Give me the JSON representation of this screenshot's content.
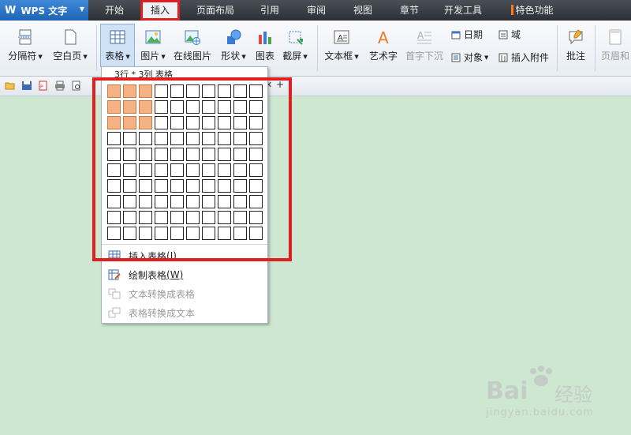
{
  "app": {
    "logo": "W",
    "name": "WPS 文字"
  },
  "menu_tabs": [
    "开始",
    "插入",
    "页面布局",
    "引用",
    "审阅",
    "视图",
    "章节",
    "开发工具",
    "特色功能"
  ],
  "ribbon": {
    "section_break": "分隔符",
    "blank_page": "空白页",
    "table": "表格",
    "picture": "图片",
    "online_picture": "在线图片",
    "shapes": "形状",
    "chart": "图表",
    "screenshot": "截屏",
    "text_box": "文本框",
    "word_art": "艺术字",
    "drop_cap": "首字下沉",
    "date": "日期",
    "object": "对象",
    "field": "域",
    "insert_attachment": "插入附件",
    "comment": "批注",
    "header_footer": "页眉和"
  },
  "table_dropdown": {
    "grid_caption": "3行 * 3列 表格",
    "rows": 10,
    "cols": 10,
    "selected_rows": 3,
    "selected_cols": 3,
    "items": [
      {
        "label": "插入表格",
        "accel": "(I)",
        "enabled": true
      },
      {
        "label": "绘制表格",
        "accel": "(W)",
        "enabled": true
      },
      {
        "label": "文本转换成表格",
        "accel": "",
        "enabled": false
      },
      {
        "label": "表格转换成文本",
        "accel": "",
        "enabled": false
      }
    ]
  },
  "watermark": {
    "brand": "Bai",
    "brand2": "经验",
    "url": "jingyan.baidu.com"
  },
  "colors": {
    "accent_red": "#e02020",
    "grid_selected": "#f4b183",
    "page_bg": "#cde7d1"
  }
}
